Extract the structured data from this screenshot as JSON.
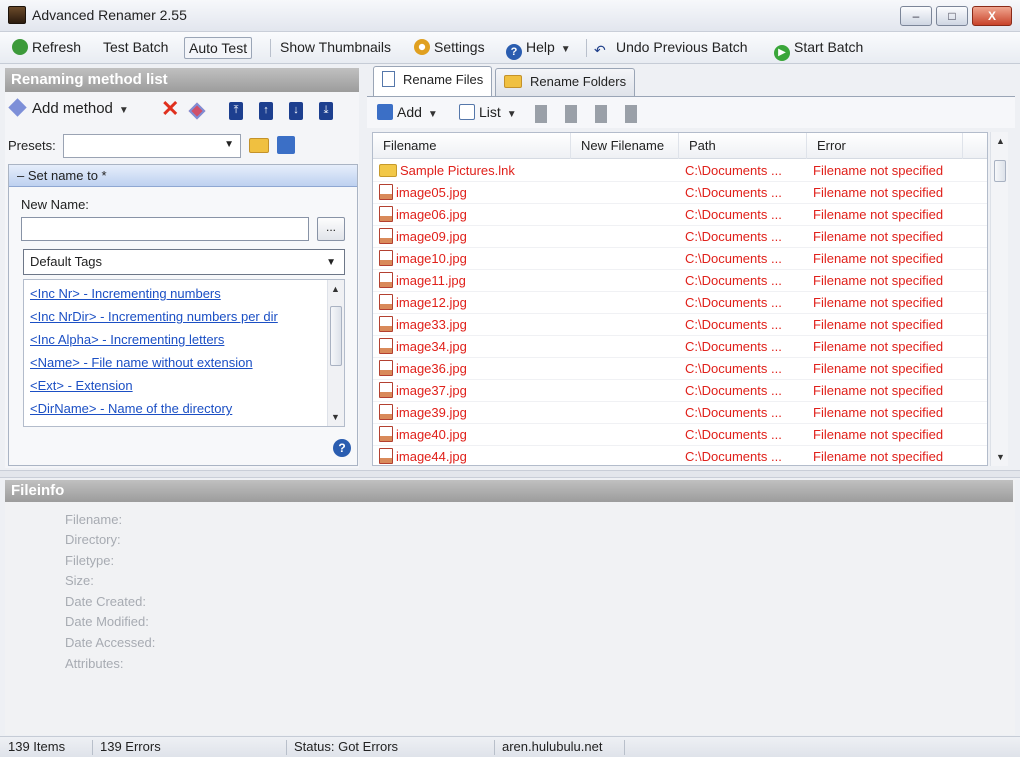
{
  "window": {
    "title": "Advanced Renamer 2.55",
    "minimize_label": "–",
    "maximize_label": "□",
    "close_label": "X"
  },
  "toolbar": {
    "refresh": "Refresh",
    "test_batch": "Test Batch",
    "auto_test": "Auto Test",
    "show_thumbnails": "Show Thumbnails",
    "settings": "Settings",
    "help": "Help",
    "undo": "Undo Previous Batch",
    "start": "Start Batch"
  },
  "left": {
    "header": "Renaming method list",
    "add_method": "Add method",
    "presets_label": "Presets:",
    "presets_value": "",
    "method_title": "Set name to *",
    "new_name_label": "New Name:",
    "new_name_value": "",
    "browse_label": "...",
    "tags_combo": "Default Tags",
    "tags": [
      "<Inc Nr> - Incrementing numbers",
      "<Inc NrDir> - Incrementing numbers per dir",
      "<Inc Alpha> - Incrementing letters",
      "<Name> - File name without extension",
      "<Ext> - Extension",
      "<DirName> - Name of the directory"
    ]
  },
  "right": {
    "tabs": [
      "Rename Files",
      "Rename Folders"
    ],
    "add": "Add",
    "list": "List",
    "columns": [
      "Filename",
      "New Filename",
      "Path",
      "Error"
    ],
    "rows": [
      {
        "name": "Sample Pictures.lnk",
        "type": "folder",
        "new": "",
        "path": "C:\\Documents ...",
        "error": "Filename not specified"
      },
      {
        "name": "image05.jpg",
        "type": "file",
        "new": "",
        "path": "C:\\Documents ...",
        "error": "Filename not specified"
      },
      {
        "name": "image06.jpg",
        "type": "file",
        "new": "",
        "path": "C:\\Documents ...",
        "error": "Filename not specified"
      },
      {
        "name": "image09.jpg",
        "type": "file",
        "new": "",
        "path": "C:\\Documents ...",
        "error": "Filename not specified"
      },
      {
        "name": "image10.jpg",
        "type": "file",
        "new": "",
        "path": "C:\\Documents ...",
        "error": "Filename not specified"
      },
      {
        "name": "image11.jpg",
        "type": "file",
        "new": "",
        "path": "C:\\Documents ...",
        "error": "Filename not specified"
      },
      {
        "name": "image12.jpg",
        "type": "file",
        "new": "",
        "path": "C:\\Documents ...",
        "error": "Filename not specified"
      },
      {
        "name": "image33.jpg",
        "type": "file",
        "new": "",
        "path": "C:\\Documents ...",
        "error": "Filename not specified"
      },
      {
        "name": "image34.jpg",
        "type": "file",
        "new": "",
        "path": "C:\\Documents ...",
        "error": "Filename not specified"
      },
      {
        "name": "image36.jpg",
        "type": "file",
        "new": "",
        "path": "C:\\Documents ...",
        "error": "Filename not specified"
      },
      {
        "name": "image37.jpg",
        "type": "file",
        "new": "",
        "path": "C:\\Documents ...",
        "error": "Filename not specified"
      },
      {
        "name": "image39.jpg",
        "type": "file",
        "new": "",
        "path": "C:\\Documents ...",
        "error": "Filename not specified"
      },
      {
        "name": "image40.jpg",
        "type": "file",
        "new": "",
        "path": "C:\\Documents ...",
        "error": "Filename not specified"
      },
      {
        "name": "image44.jpg",
        "type": "file",
        "new": "",
        "path": "C:\\Documents ...",
        "error": "Filename not specified"
      }
    ]
  },
  "fileinfo": {
    "header": "Fileinfo",
    "labels": [
      "Filename:",
      "Directory:",
      "Filetype:",
      "Size:",
      "Date Created:",
      "Date Modified:",
      "Date Accessed:",
      "Attributes:"
    ]
  },
  "status": {
    "items": "139 Items",
    "errors": "139 Errors",
    "status": "Status: Got Errors",
    "site": "aren.hulubulu.net"
  },
  "colors": {
    "error_text": "#e0201a",
    "link": "#1b4fc4",
    "panel_header": "#9c9c9c"
  }
}
